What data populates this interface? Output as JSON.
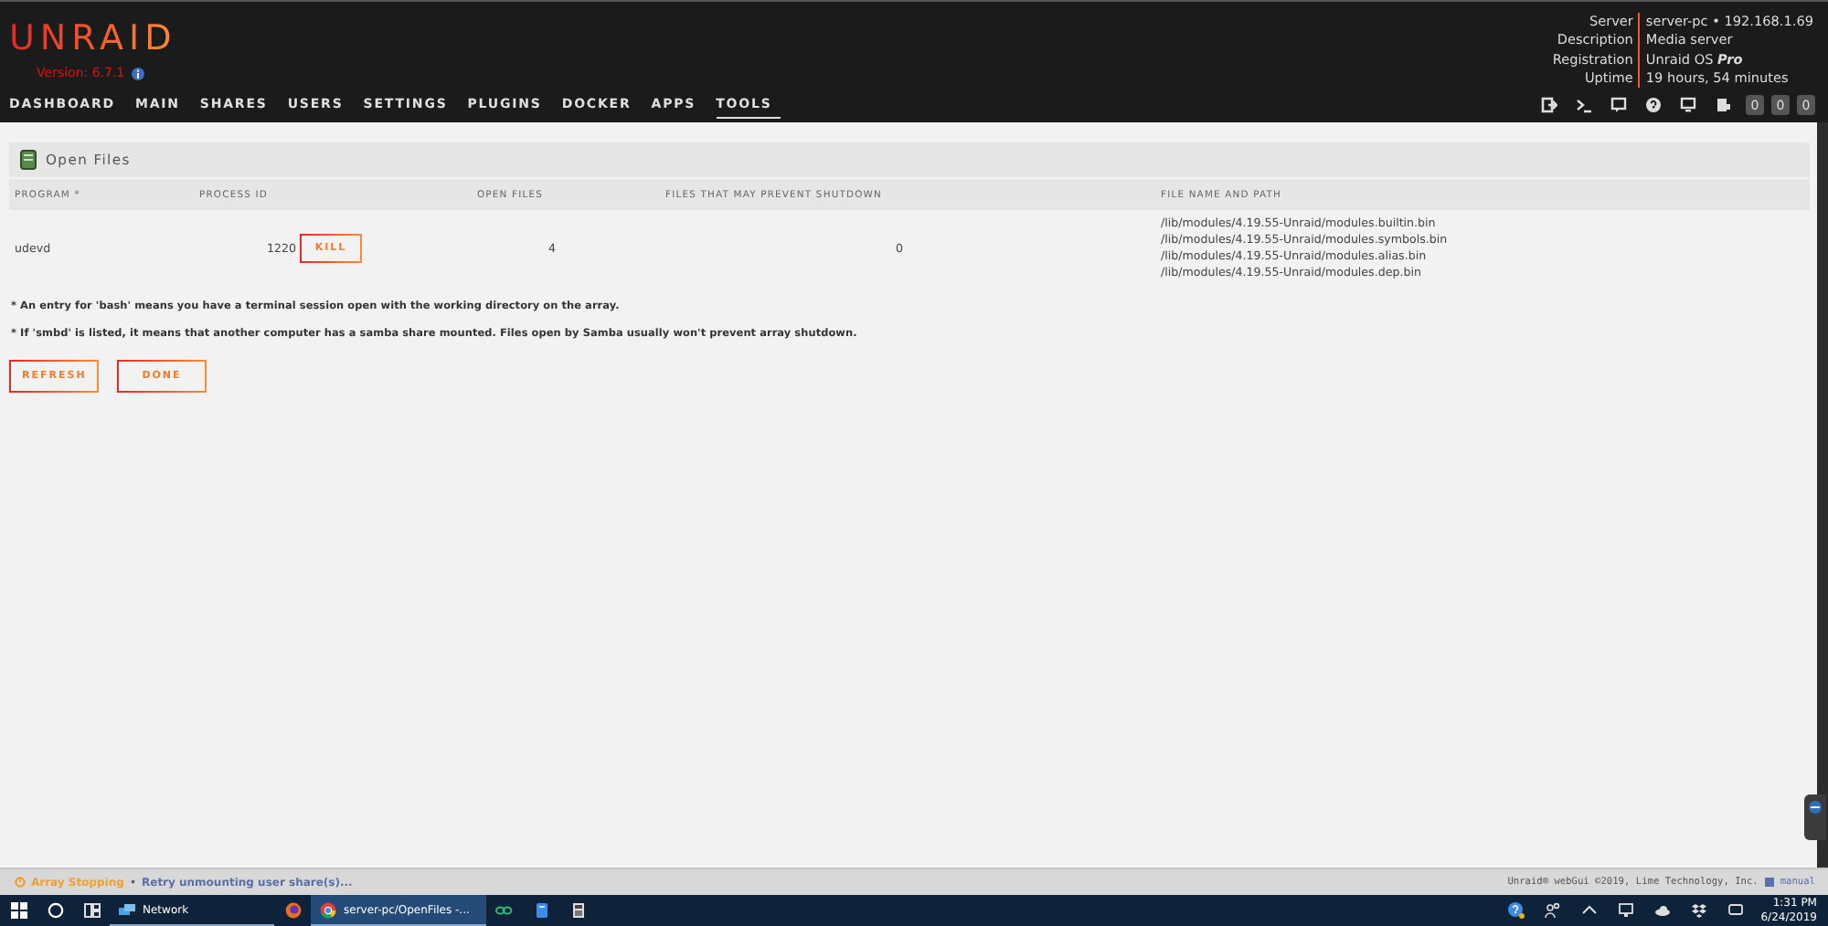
{
  "logo": {
    "text": "UNRAID",
    "version": "Version: 6.7.1"
  },
  "server_info": [
    {
      "label": "Server",
      "value": "server-pc • 192.168.1.69"
    },
    {
      "label": "Description",
      "value": "Media server"
    },
    {
      "label": "Registration",
      "value": "Unraid OS **Pro**"
    },
    {
      "label": "Uptime",
      "value": "19 hours, 54 minutes"
    }
  ],
  "nav": [
    {
      "label": "DASHBOARD",
      "selected": false
    },
    {
      "label": "MAIN",
      "selected": false
    },
    {
      "label": "SHARES",
      "selected": false
    },
    {
      "label": "USERS",
      "selected": false
    },
    {
      "label": "SETTINGS",
      "selected": false
    },
    {
      "label": "PLUGINS",
      "selected": false
    },
    {
      "label": "DOCKER",
      "selected": false
    },
    {
      "label": "APPS",
      "selected": false
    },
    {
      "label": "TOOLS",
      "selected": true
    }
  ],
  "toolbar_badges": [
    "0",
    "0",
    "0"
  ],
  "panel": {
    "title": "Open Files",
    "columns": [
      "PROGRAM *",
      "PROCESS ID",
      "OPEN FILES",
      "FILES THAT MAY PREVENT SHUTDOWN",
      "FILE NAME AND PATH"
    ],
    "rows": [
      {
        "program": "udevd",
        "process_id": "1220",
        "action": "KILL",
        "open_files": "4",
        "prevent_shutdown": "0",
        "paths": [
          "/lib/modules/4.19.55-Unraid/modules.builtin.bin",
          "/lib/modules/4.19.55-Unraid/modules.symbols.bin",
          "/lib/modules/4.19.55-Unraid/modules.alias.bin",
          "/lib/modules/4.19.55-Unraid/modules.dep.bin"
        ]
      }
    ]
  },
  "notes": [
    "* An entry for 'bash' means you have a terminal session open with the working directory on the array.",
    "* If 'smbd' is listed, it means that another computer has a samba share mounted. Files open by Samba usually won't prevent array shutdown."
  ],
  "buttons": [
    "REFRESH",
    "DONE"
  ],
  "status": {
    "state": "Array Stopping",
    "separator": "•",
    "message": "Retry unmounting user share(s)...",
    "copyright": "Unraid® webGui ©2019, Lime Technology, Inc.",
    "manual": "manual"
  },
  "taskbar": {
    "apps": [
      {
        "label": "Network",
        "selected": false
      },
      {
        "label": "server-pc/OpenFiles -...",
        "selected": true
      }
    ],
    "time": "1:31 PM",
    "date": "6/24/2019"
  }
}
